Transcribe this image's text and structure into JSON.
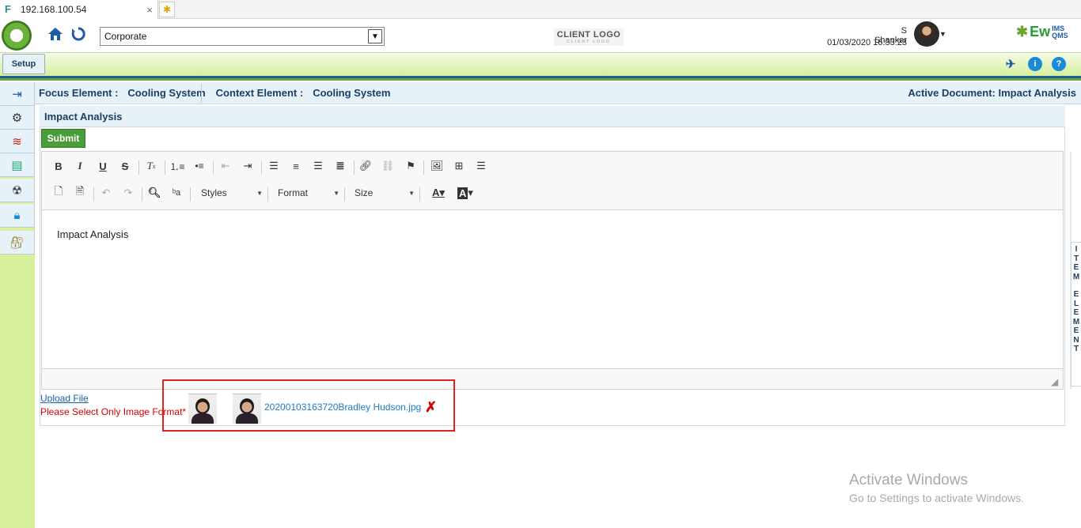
{
  "browser": {
    "tab_title": "192.168.100.54",
    "close_glyph": "×",
    "new_tab_glyph": "✱"
  },
  "header": {
    "org_select_value": "Corporate",
    "client_logo": "CLIENT LOGO",
    "client_logo_sub": "CLIENT LOGO",
    "user_name": "S Shankar",
    "datetime": "01/03/2020 16:33:23",
    "brand": "Ew",
    "brand_small_top": "IMS",
    "brand_small_bottom": "QMS"
  },
  "setupbar": {
    "setup_label": "Setup"
  },
  "context": {
    "focus_label": "Focus Element :",
    "focus_value": "Cooling System",
    "context_label": "Context Element :",
    "context_value": "Cooling System",
    "active_doc": "Active Document: Impact Analysis"
  },
  "panel": {
    "title": "Impact Analysis",
    "submit_label": "Submit",
    "editor_content": "Impact Analysis",
    "styles_label": "Styles",
    "format_label": "Format",
    "size_label": "Size"
  },
  "upload": {
    "link_label": "Upload File",
    "note": "Please Select Only Image Format*",
    "file_name": "20200103163720Bradley Hudson.jpg"
  },
  "vertical_tab": [
    "I",
    "T",
    "E",
    "M",
    "",
    "E",
    "L",
    "E",
    "M",
    "E",
    "N",
    "T"
  ],
  "watermark": {
    "title": "Activate Windows",
    "subtitle": "Go to Settings to activate Windows."
  },
  "colors": {
    "accent_blue": "#1b5ea6",
    "green": "#6aa72e",
    "error_red": "#d40000"
  }
}
